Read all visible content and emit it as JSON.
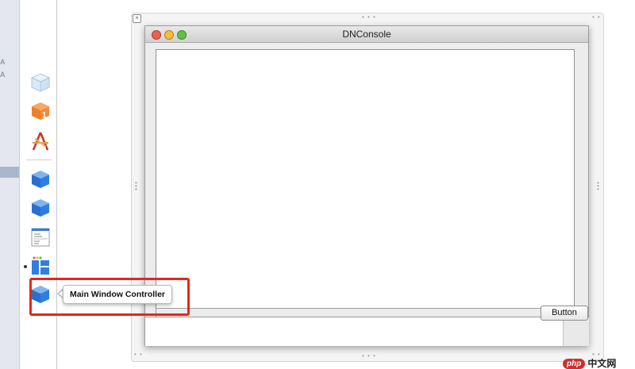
{
  "navigator": {
    "marks": [
      "A",
      "A"
    ]
  },
  "dock": {
    "items": [
      {
        "icon": "cube-outline-icon",
        "label": ""
      },
      {
        "icon": "first-responder-cube-icon",
        "label": ""
      },
      {
        "icon": "application-icon",
        "label": ""
      },
      {
        "icon": "blue-object-cube-icon",
        "label": ""
      },
      {
        "icon": "blue-object-cube-icon",
        "label": ""
      },
      {
        "icon": "main-menu-icon",
        "label": ""
      },
      {
        "icon": "window-icon",
        "label": ""
      },
      {
        "icon": "blue-object-cube-icon",
        "label": ""
      }
    ]
  },
  "window": {
    "title": "DNConsole",
    "button_label": "Button"
  },
  "tooltip": {
    "text": "Main Window Controller"
  },
  "watermark": {
    "logo": "php",
    "text": "中文网"
  },
  "colors": {
    "highlight": "#e8251b",
    "close_light": "#ed5e55",
    "minimize_light": "#f5bd3b",
    "zoom_light": "#5fc23f",
    "cube_blue": "#2f7fe0",
    "cube_orange": "#f08a3c"
  }
}
